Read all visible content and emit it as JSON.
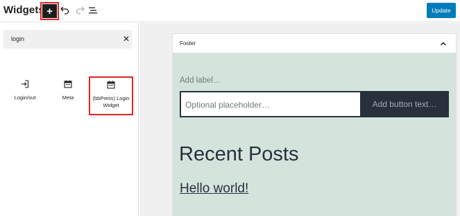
{
  "header": {
    "title": "Widgets",
    "add_label": "+",
    "update_label": "Update"
  },
  "inserter": {
    "search_value": "login",
    "clear_label": "✕",
    "blocks": [
      {
        "label": "Login/out",
        "icon": "login-icon"
      },
      {
        "label": "Meta",
        "icon": "calendar-icon"
      },
      {
        "label": "(bbPress) Login Widget",
        "icon": "calendar-icon",
        "highlighted": true
      }
    ]
  },
  "editor": {
    "area_title": "Footer",
    "search_block": {
      "label": "Add label…",
      "placeholder": "Optional placeholder…",
      "button_text": "Add button text…"
    },
    "recent_posts_heading": "Recent Posts",
    "posts": [
      "Hello world!"
    ]
  },
  "colors": {
    "accent": "#007cba",
    "highlight": "#e02424",
    "canvas_bg": "#d4e4dd",
    "dark": "#28303d"
  }
}
